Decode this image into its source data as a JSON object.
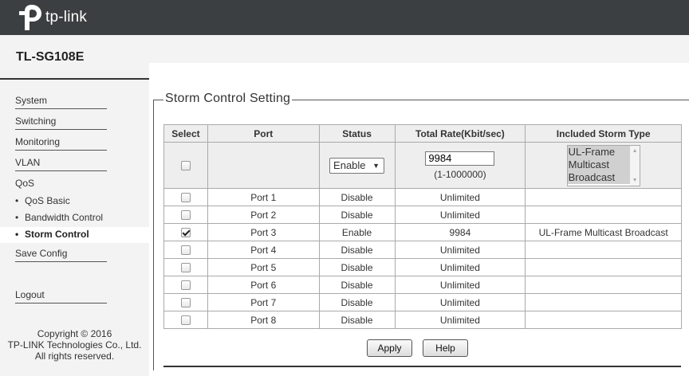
{
  "header": {
    "logo_text": "tp-link",
    "logo_icon": "tp-link-logo-icon",
    "bg_color": "#3c3f41"
  },
  "sidebar": {
    "model": "TL-SG108E",
    "items": [
      {
        "label": "System"
      },
      {
        "label": "Switching"
      },
      {
        "label": "Monitoring"
      },
      {
        "label": "VLAN"
      },
      {
        "label": "QoS"
      }
    ],
    "qos_sub": [
      {
        "label": "QoS Basic"
      },
      {
        "label": "Bandwidth Control"
      },
      {
        "label": "Storm Control",
        "active": true
      }
    ],
    "save_config": "Save Config",
    "logout": "Logout",
    "copyright": [
      "Copyright © 2016",
      "TP-LINK Technologies Co., Ltd.",
      "All rights reserved."
    ]
  },
  "main": {
    "section_title": "Storm Control Setting",
    "columns": [
      "Select",
      "Port",
      "Status",
      "Total Rate(Kbit/sec)",
      "Included Storm Type"
    ],
    "config": {
      "selected": false,
      "status_value": "Enable",
      "rate_value": "9984",
      "rate_hint": "(1-1000000)",
      "storm_types": [
        "UL-Frame",
        "Multicast",
        "Broadcast"
      ]
    },
    "rows": [
      {
        "checked": false,
        "port": "Port 1",
        "status": "Disable",
        "rate": "Unlimited",
        "types": ""
      },
      {
        "checked": false,
        "port": "Port 2",
        "status": "Disable",
        "rate": "Unlimited",
        "types": ""
      },
      {
        "checked": true,
        "port": "Port 3",
        "status": "Enable",
        "rate": "9984",
        "types": "UL-Frame Multicast Broadcast"
      },
      {
        "checked": false,
        "port": "Port 4",
        "status": "Disable",
        "rate": "Unlimited",
        "types": ""
      },
      {
        "checked": false,
        "port": "Port 5",
        "status": "Disable",
        "rate": "Unlimited",
        "types": ""
      },
      {
        "checked": false,
        "port": "Port 6",
        "status": "Disable",
        "rate": "Unlimited",
        "types": ""
      },
      {
        "checked": false,
        "port": "Port 7",
        "status": "Disable",
        "rate": "Unlimited",
        "types": ""
      },
      {
        "checked": false,
        "port": "Port 8",
        "status": "Disable",
        "rate": "Unlimited",
        "types": ""
      }
    ],
    "apply_label": "Apply",
    "help_label": "Help"
  }
}
